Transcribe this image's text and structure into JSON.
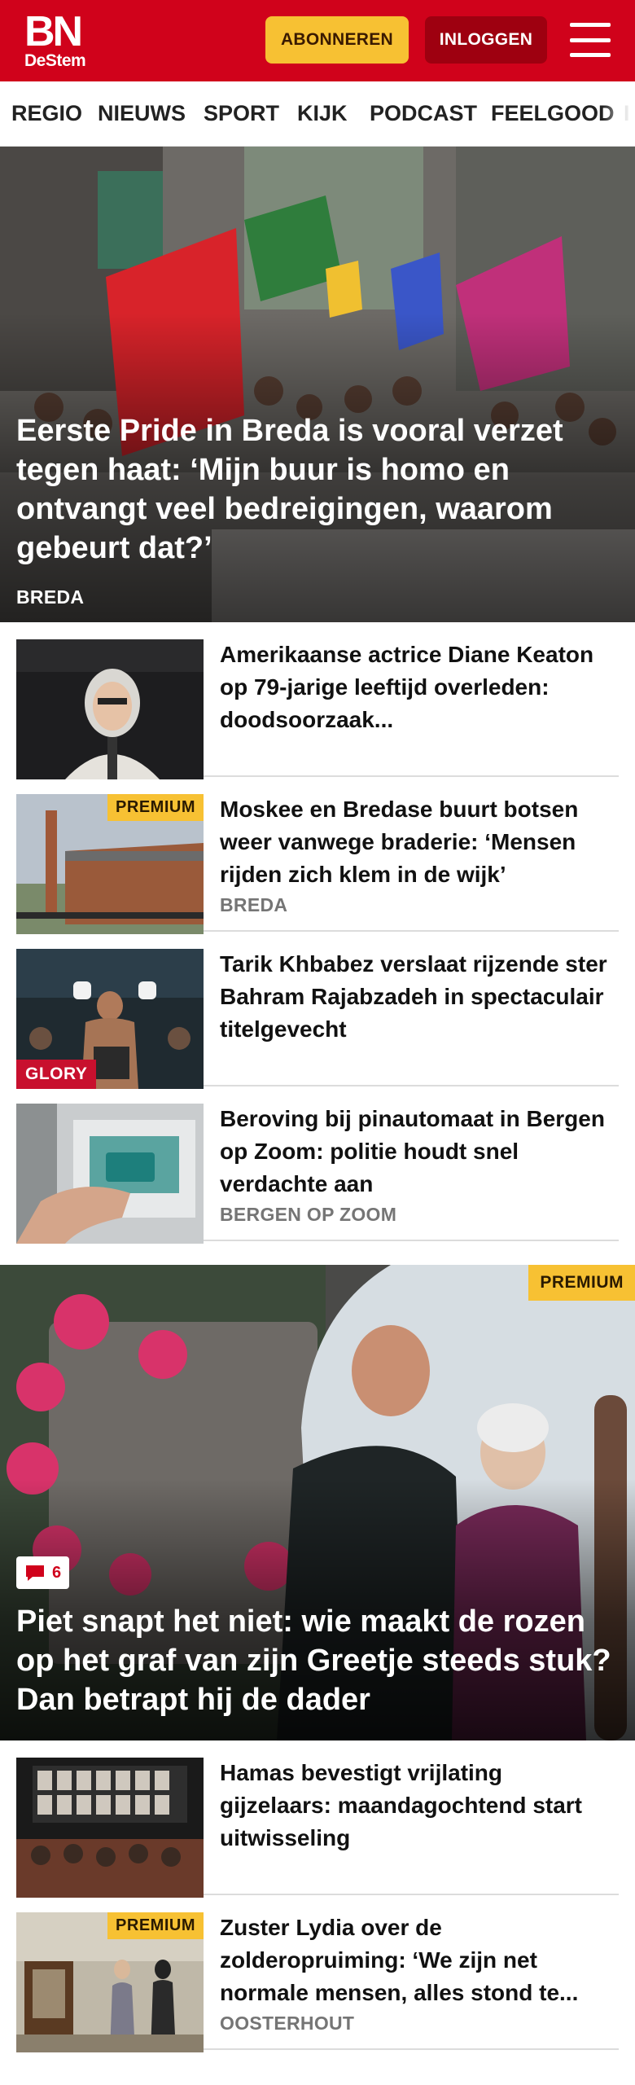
{
  "header": {
    "logo_main": "BN",
    "logo_sub": "DeStem",
    "subscribe_label": "ABONNEREN",
    "login_label": "INLOGGEN",
    "colors": {
      "brand_red": "#d0021b",
      "subscribe_yellow": "#f7c133",
      "login_dark": "#9e0010"
    }
  },
  "nav": {
    "items": [
      "REGIO",
      "NIEUWS",
      "SPORT",
      "KIJK",
      "PODCAST",
      "FEELGOOD",
      "I"
    ]
  },
  "hero": {
    "title": "Eerste Pride in Breda is vooral verzet tegen haat: ‘Mijn buur is homo en ontvangt veel bedreigingen, waarom gebeurt dat?’",
    "category": "BREDA"
  },
  "articles": [
    {
      "title": "Amerikaanse actrice Diane Keaton op 79-jarige leeftijd overleden: doodsoorzaak...",
      "category": "",
      "badge": ""
    },
    {
      "title": "Moskee en Bredase buurt botsen weer vanwege braderie: ‘Mensen rijden zich klem in de wijk’",
      "category": "BREDA",
      "badge": "PREMIUM"
    },
    {
      "title": "Tarik Khbabez verslaat rijzende ster Bahram Rajabzadeh in spectaculair titelgevecht",
      "category": "",
      "badge": "GLORY"
    },
    {
      "title": "Beroving bij pinautomaat in Bergen op Zoom: politie houdt snel verdachte aan",
      "category": "BERGEN OP ZOOM",
      "badge": ""
    }
  ],
  "feature": {
    "title": "Piet snapt het niet: wie maakt de rozen op het graf van zijn Greetje steeds stuk? Dan betrapt hij de dader",
    "badge": "PREMIUM",
    "comments": "6"
  },
  "articles2": [
    {
      "title": "Hamas bevestigt vrijlating gijzelaars: maandagochtend start uitwisseling",
      "category": "",
      "badge": ""
    },
    {
      "title": "Zuster Lydia over de zolderopruiming: ‘We zijn net normale mensen, alles stond te...",
      "category": "OOSTERHOUT",
      "badge": "PREMIUM"
    }
  ]
}
